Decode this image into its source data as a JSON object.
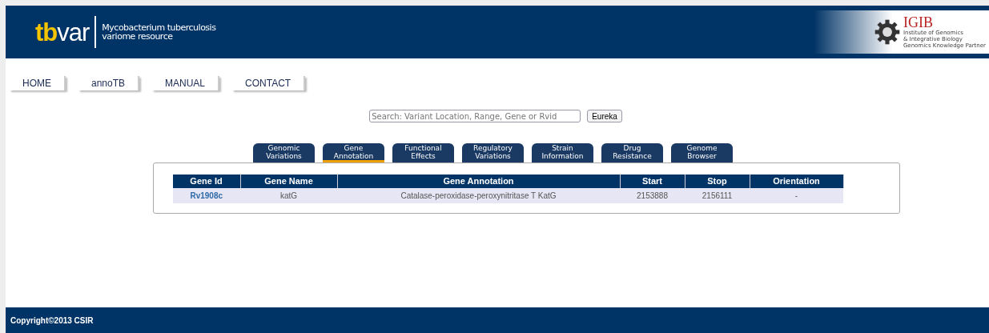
{
  "header": {
    "logo": {
      "highlight": "tb",
      "rest": "var"
    },
    "tagline": [
      "Mycobacterium tuberculosis",
      "variome resource"
    ],
    "institute": {
      "name": "IGIB",
      "lines": [
        "Institute of Genomics",
        "& Integrative Biology",
        "Genomics Knowledge Partner"
      ]
    }
  },
  "nav": [
    "HOME",
    "annoTB",
    "MANUAL",
    "CONTACT"
  ],
  "search": {
    "placeholder": "Search: Variant Location, Range, Gene or Rvid",
    "button": "Eureka"
  },
  "tabs": [
    {
      "label": "Genomic Variations",
      "selected": false
    },
    {
      "label": "Gene Annotation",
      "selected": true
    },
    {
      "label": "Functional Effects",
      "selected": false
    },
    {
      "label": "Regulatory Variations",
      "selected": false
    },
    {
      "label": "Strain Information",
      "selected": false
    },
    {
      "label": "Drug Resistance",
      "selected": false
    },
    {
      "label": "Genome Browser",
      "selected": false
    }
  ],
  "table": {
    "columns": [
      "Gene Id",
      "Gene Name",
      "Gene Annotation",
      "Start",
      "Stop",
      "Orientation"
    ],
    "rows": [
      [
        "Rv1908c",
        "katG",
        "Catalase-peroxidase-peroxynitritase T KatG",
        "2153888",
        "2156111",
        "-"
      ]
    ]
  },
  "footer": "Copyright©2013 CSIR"
}
